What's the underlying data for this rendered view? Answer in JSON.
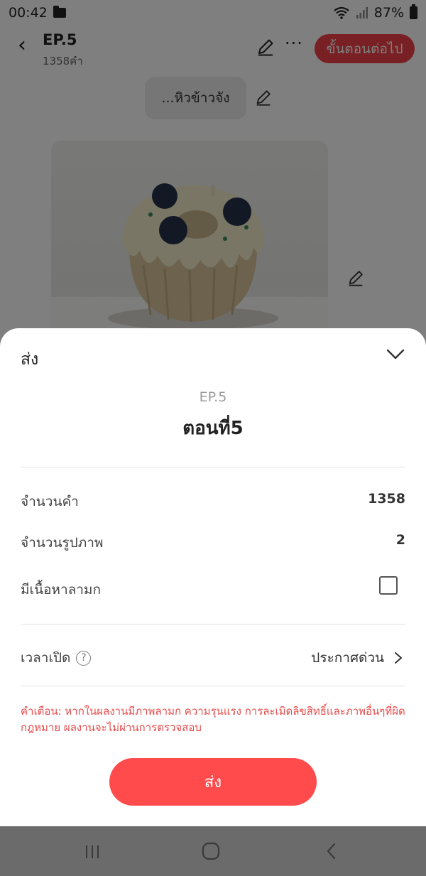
{
  "status_bar": {
    "time": "00:42",
    "battery": "87%"
  },
  "header": {
    "ep_title": "EP.5",
    "word_count": "1358คำ",
    "next_button": "ขั้นตอนต่อไป"
  },
  "editor": {
    "message_bubble": "...หิวข้าวจัง"
  },
  "sheet": {
    "title": "ส่ง",
    "ep_label": "EP.5",
    "episode_name": "ตอนที่5",
    "rows": [
      {
        "label": "จำนวนคำ",
        "value": "1358"
      },
      {
        "label": "จำนวนรูปภาพ",
        "value": "2"
      }
    ],
    "nsfw_label": "มีเนื้อหาลามก",
    "nsfw_checked": false,
    "open_time_label": "เวลาเปิด",
    "help_icon_glyph": "?",
    "open_time_value": "ประกาศด่วน",
    "warning": "คำเตือน:  หากในผลงานมีภาพลามก  ความรุนแรง  การละเมิดลิขสิทธิ์และภาพอื่นๆที่ผิดกฎหมาย ผลงานจะไม่ผ่านการตรวจสอบ",
    "send_button": "ส่ง"
  },
  "colors": {
    "accent_red": "#ff4b4b",
    "warning_red": "#e64b4b",
    "dim_overlay": "rgba(0,0,0,0.5)"
  },
  "icons": [
    "folder-icon",
    "wifi-icon",
    "signal-icon",
    "battery-icon",
    "back-arrow-icon",
    "pencil-icon",
    "more-icon",
    "chevron-down-icon",
    "help-icon",
    "chevron-right-icon",
    "recents-icon",
    "home-icon",
    "nav-back-icon"
  ]
}
